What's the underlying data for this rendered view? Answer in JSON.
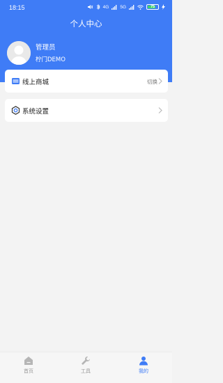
{
  "status_bar": {
    "time": "18:15",
    "signal_labels": [
      "4G",
      "5G"
    ],
    "battery_level": "75",
    "battery_fraction": 0.75
  },
  "header": {
    "title": "个人中心",
    "background_color": "#3f7cf6"
  },
  "profile": {
    "name": "管理员",
    "company": "柠门DEMO"
  },
  "menu": {
    "online_mall": {
      "label": "线上商城",
      "action": "切换",
      "icon": "store-icon"
    },
    "settings": {
      "label": "系统设置",
      "icon": "settings-icon"
    }
  },
  "tabbar": {
    "items": [
      {
        "label": "首页",
        "icon": "home-icon",
        "active": false
      },
      {
        "label": "工具",
        "icon": "wrench-icon",
        "active": false
      },
      {
        "label": "我的",
        "icon": "person-icon",
        "active": true
      }
    ],
    "active_color": "#3f7cf6",
    "inactive_color": "#b5b5b5"
  }
}
